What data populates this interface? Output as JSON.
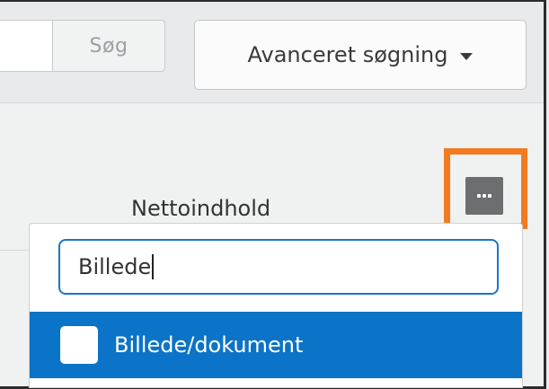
{
  "toolbar": {
    "search_button_label": "Søg",
    "advanced_search_label": "Avanceret søgning"
  },
  "table": {
    "column_header": "Nettoindhold"
  },
  "dropdown": {
    "filter_value": "Billede",
    "options": [
      {
        "label": "Billede/dokument",
        "checked": false,
        "highlighted": true
      }
    ]
  },
  "colors": {
    "accent": "#0b74c8",
    "highlight_box": "#f37a1f",
    "more_button": "#6d6e6f"
  },
  "icons": [
    "chevron-down-icon",
    "more-icon"
  ]
}
